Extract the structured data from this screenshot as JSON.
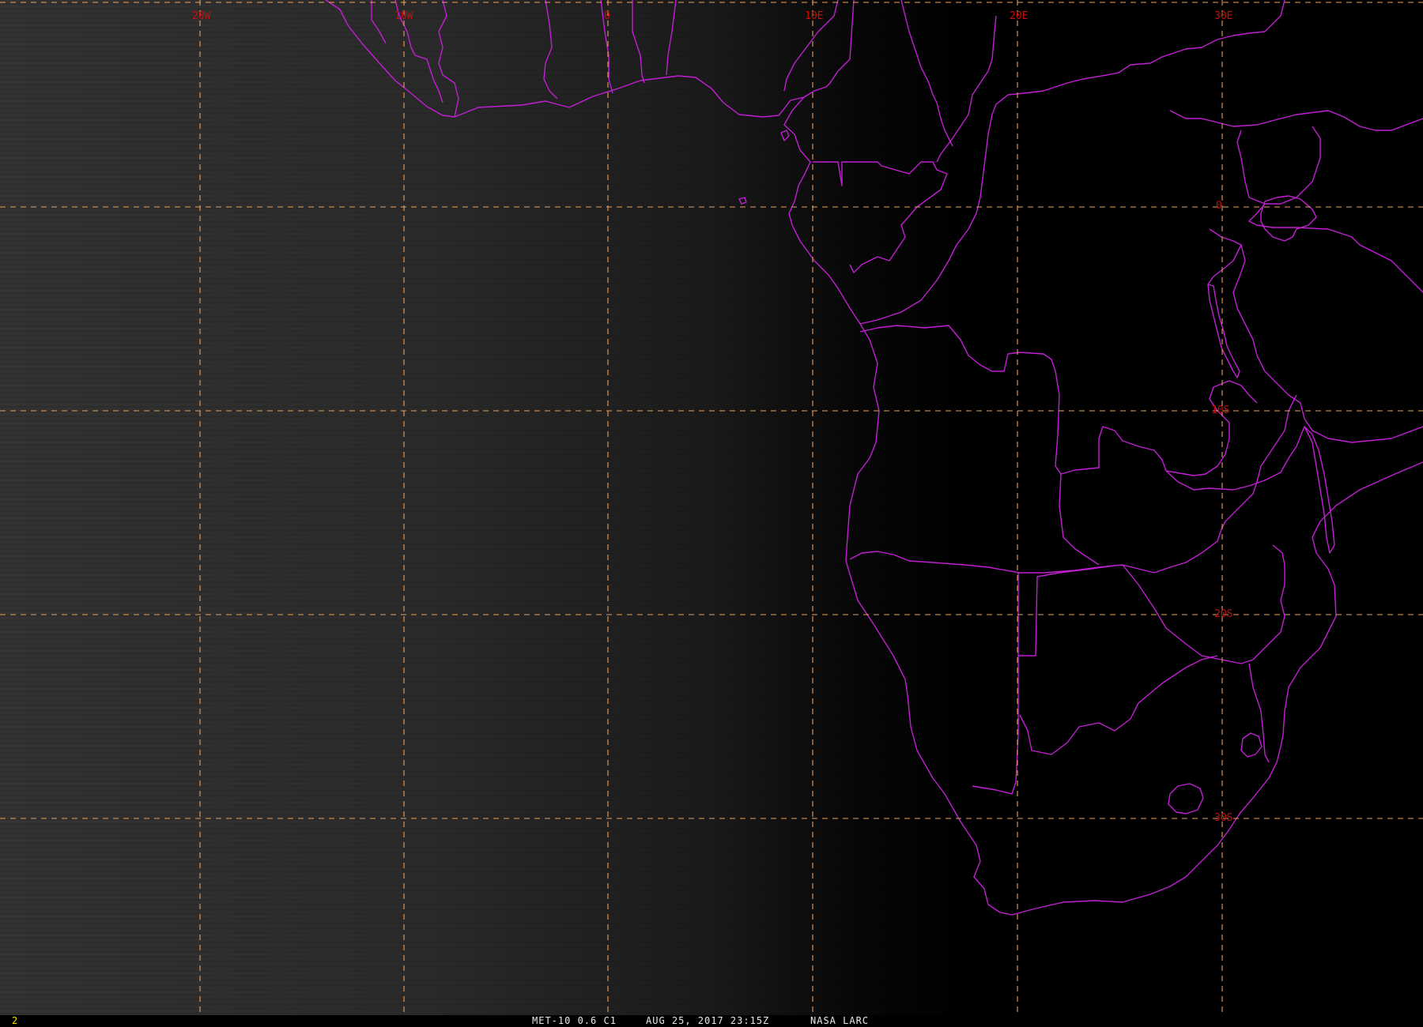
{
  "display": {
    "frame_number": "2",
    "satellite_product": "MET-10 0.6 C1",
    "datetime": "AUG 25, 2017 23:15Z",
    "source": "NASA LARC"
  },
  "grid": {
    "longitude_labels": [
      "20W",
      "10W",
      "0",
      "10E",
      "20E",
      "30E"
    ],
    "latitude_labels": [
      "0",
      "10S",
      "20S",
      "30S"
    ]
  },
  "colors": {
    "background": "#000000",
    "grid_lines": "#e9a15e",
    "grid_labels": "#c80f0f",
    "political_boundaries": "#c21fd4",
    "frame_number": "#f2e000",
    "status_text": "#e8e8e8"
  },
  "imagery": {
    "channel": "visible 0.6 micron",
    "terminator": "dusk illumination on western (ocean) side, night over continent"
  }
}
